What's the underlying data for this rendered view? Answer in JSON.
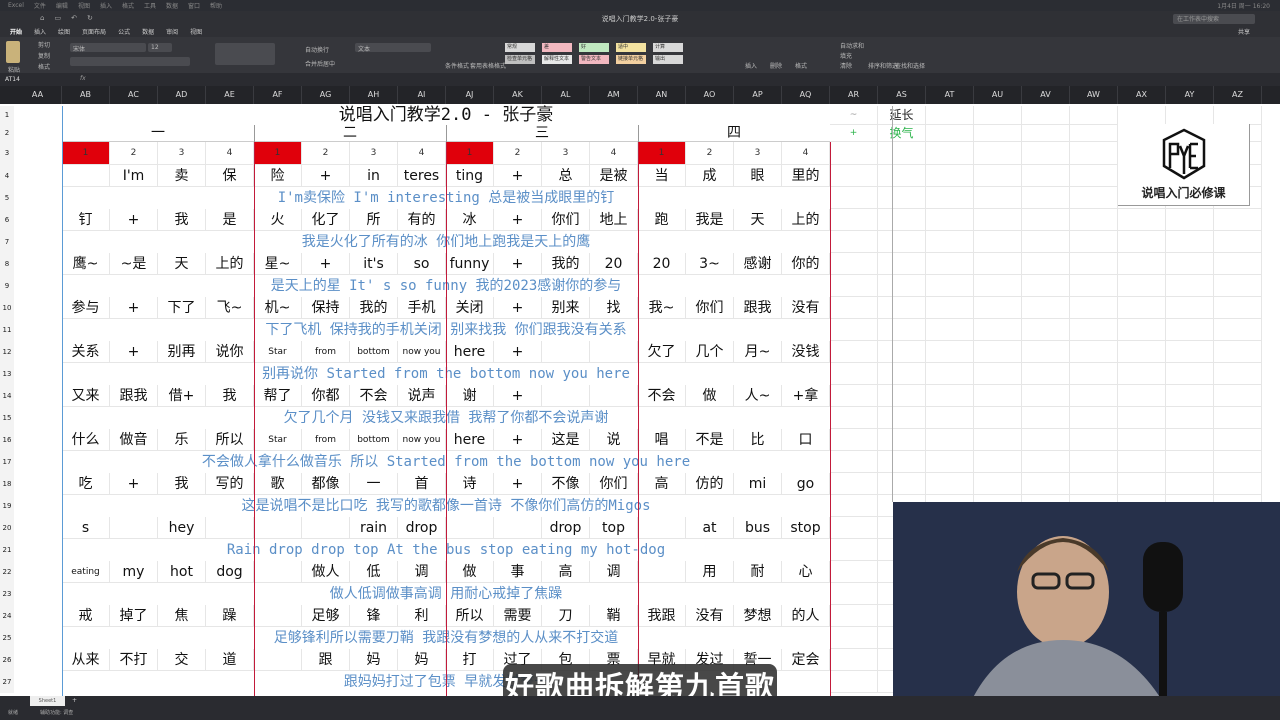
{
  "menubar": {
    "items": [
      "Excel",
      "文件",
      "编辑",
      "视图",
      "插入",
      "格式",
      "工具",
      "数据",
      "窗口",
      "帮助"
    ],
    "status": "1月4日 周一 16:20"
  },
  "window": {
    "title": "说唱入门教学2.0-张子豪",
    "search_placeholder": "在工作表中搜索"
  },
  "tabs": [
    "开始",
    "插入",
    "绘图",
    "页面布局",
    "公式",
    "数据",
    "审阅",
    "视图"
  ],
  "share": "共享",
  "ribbon": {
    "paste": "粘贴",
    "cut": "剪切",
    "copy": "复制",
    "format": "格式",
    "font": "宋体",
    "size": "12",
    "wrap": "自动换行",
    "merge": "合并后居中",
    "numfmt": "文本",
    "cond": "条件格式",
    "table": "套用表格格式",
    "styles": [
      "常规",
      "差",
      "好",
      "适中",
      "计算",
      "检查单元格",
      "解释性文本",
      "警告文本",
      "链接单元格",
      "输出"
    ],
    "insert": "插入",
    "delete": "删除",
    "formatc": "格式",
    "sum": "自动求和",
    "fill": "填充",
    "clear": "清除",
    "sort": "排序和筛选",
    "find": "查找和选择"
  },
  "formula": {
    "name_box": "AT14",
    "fx": "fx"
  },
  "columns": [
    "AA",
    "AB",
    "AC",
    "AD",
    "AE",
    "AF",
    "AG",
    "AH",
    "AI",
    "AJ",
    "AK",
    "AL",
    "AM",
    "AN",
    "AO",
    "AP",
    "AQ",
    "AR",
    "AS",
    "AT",
    "AU",
    "AV",
    "AW",
    "AX",
    "AY",
    "AZ"
  ],
  "sheet": {
    "title": "说唱入门教学2.0 - 张子豪",
    "sections": [
      "一",
      "二",
      "三",
      "四"
    ],
    "beats": [
      "1",
      "2",
      "3",
      "4",
      "1",
      "2",
      "3",
      "4",
      "1",
      "2",
      "3",
      "4",
      "1",
      "2",
      "3",
      "4"
    ],
    "legend": [
      {
        "mark": "~",
        "label": "延长",
        "color": "#222222"
      },
      {
        "mark": "+",
        "label": "换气",
        "color": "#2bb34a"
      }
    ],
    "rows": [
      {
        "cells": [
          "",
          "I'm",
          "卖",
          "保",
          "险",
          "+",
          "in",
          "teres",
          "ting",
          "+",
          "总",
          "是被",
          "当",
          "成",
          "眼",
          "里的"
        ],
        "lyric": "I'm卖保险 I'm interesting 总是被当成眼里的钉"
      },
      {
        "cells": [
          "钉",
          "+",
          "我",
          "是",
          "火",
          "化了",
          "所",
          "有的",
          "冰",
          "+",
          "你们",
          "地上",
          "跑",
          "我是",
          "天",
          "上的"
        ],
        "lyric": "我是火化了所有的冰 你们地上跑我是天上的鹰"
      },
      {
        "cells": [
          "鹰~",
          "~是",
          "天",
          "上的",
          "星~",
          "+",
          "it's",
          "so",
          "funny",
          "+",
          "我的",
          "20",
          "20",
          "3~",
          "感谢",
          "你的"
        ],
        "lyric": "是天上的星 It' s so funny 我的2023感谢你的参与"
      },
      {
        "cells": [
          "参与",
          "+",
          "下了",
          "飞~",
          "机~",
          "保持",
          "我的",
          "手机",
          "关闭",
          "+",
          "别来",
          "找",
          "我~",
          "你们",
          "跟我",
          "没有"
        ],
        "lyric": "下了飞机 保持我的手机关闭 别来找我 你们跟我没有关系"
      },
      {
        "cells": [
          "关系",
          "+",
          "别再",
          "说你",
          "Star",
          "from",
          "bottom",
          "now you",
          "here",
          "+",
          "",
          "",
          "欠了",
          "几个",
          "月~",
          "没钱"
        ],
        "lyric": "别再说你 Started from the bottom now you here"
      },
      {
        "cells": [
          "又来",
          "跟我",
          "借+",
          "我",
          "帮了",
          "你都",
          "不会",
          "说声",
          "谢",
          "+",
          "",
          "",
          "不会",
          "做",
          "人~",
          "+拿"
        ],
        "lyric": "欠了几个月 没钱又来跟我借 我帮了你都不会说声谢"
      },
      {
        "cells": [
          "什么",
          "做音",
          "乐",
          "所以",
          "Star",
          "from",
          "bottom",
          "now you",
          "here",
          "+",
          "这是",
          "说",
          "唱",
          "不是",
          "比",
          "口"
        ],
        "lyric": "不会做人拿什么做音乐 所以 Started from the bottom now you here"
      },
      {
        "cells": [
          "吃",
          "+",
          "我",
          "写的",
          "歌",
          "都像",
          "一",
          "首",
          "诗",
          "+",
          "不像",
          "你们",
          "高",
          "仿的",
          "mi",
          "go"
        ],
        "lyric": "这是说唱不是比口吃 我写的歌都像一首诗 不像你们高仿的Migos"
      },
      {
        "cells": [
          "s",
          "",
          "hey",
          "",
          "",
          "",
          "rain",
          "drop",
          "",
          "",
          "drop",
          "top",
          "",
          "at",
          "bus",
          "stop"
        ],
        "lyric": "Rain drop drop top At the bus stop eating my hot-dog"
      },
      {
        "cells": [
          "eating",
          "my",
          "hot",
          "dog",
          "",
          "做人",
          "低",
          "调",
          "做",
          "事",
          "高",
          "调",
          "",
          "用",
          "耐",
          "心"
        ],
        "lyric": "做人低调做事高调 用耐心戒掉了焦躁"
      },
      {
        "cells": [
          "戒",
          "掉了",
          "焦",
          "躁",
          "",
          "足够",
          "锋",
          "利",
          "所以",
          "需要",
          "刀",
          "鞘",
          "我跟",
          "没有",
          "梦想",
          "的人"
        ],
        "lyric": "足够锋利所以需要刀鞘 我跟没有梦想的人从来不打交道"
      },
      {
        "cells": [
          "从来",
          "不打",
          "交",
          "道",
          "",
          "跟",
          "妈",
          "妈",
          "打",
          "过了",
          "包",
          "票",
          "早就",
          "发过",
          "誓一",
          "定会"
        ],
        "lyric": "跟妈妈打过了包票 早就发过誓一"
      }
    ]
  },
  "logo": {
    "mark": "PYE",
    "caption": "说唱入门必修课"
  },
  "sheet_tab": "Sheet1",
  "status": "就绪",
  "accessibility": "辅助功能: 调查",
  "subtitle": "好歌曲拆解第九首歌"
}
